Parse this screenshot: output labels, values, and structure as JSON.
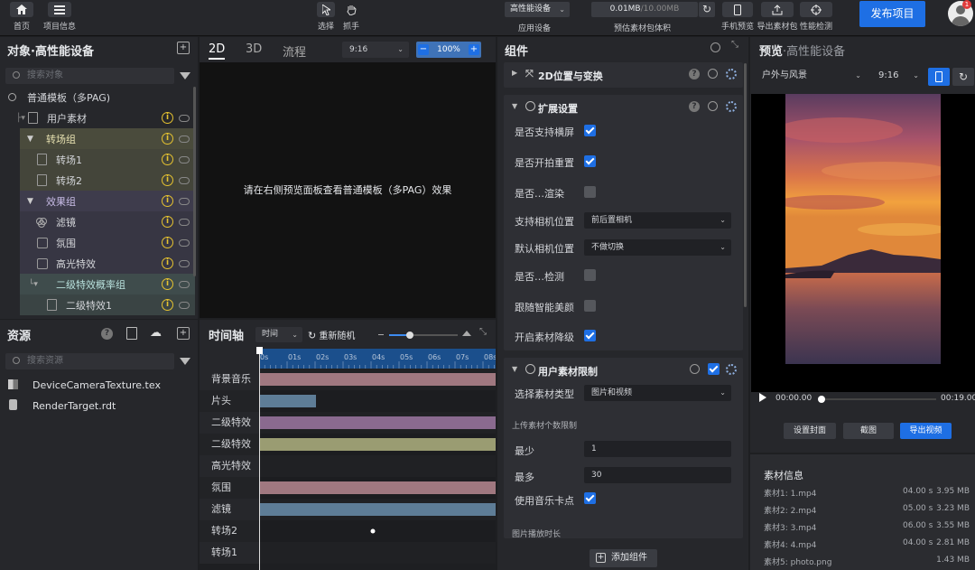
{
  "toolbar": {
    "home": "首页",
    "project_info": "项目信息",
    "select": "选择",
    "hand": "抓手",
    "device": "高性能设备",
    "apply_device": "应用设备",
    "size_used": "0.01MB",
    "size_total": "/10.00MB",
    "size_label": "预估素材包体积",
    "mobile_preview": "手机预览",
    "export_package": "导出素材包",
    "perf_check": "性能检测",
    "publish": "发布项目",
    "notif_count": "1"
  },
  "objects_panel": {
    "title": "对象·高性能设备",
    "search_placeholder": "搜索对象",
    "items": [
      {
        "label": "普通模板（多PAG)"
      },
      {
        "label": "用户素材"
      },
      {
        "label": "转场组"
      },
      {
        "label": "转场1"
      },
      {
        "label": "转场2"
      },
      {
        "label": "效果组"
      },
      {
        "label": "滤镜"
      },
      {
        "label": "氛围"
      },
      {
        "label": "高光特效"
      },
      {
        "label": "二级特效概率组"
      },
      {
        "label": "二级特效1"
      }
    ]
  },
  "canvas": {
    "tabs": [
      "2D",
      "3D",
      "流程"
    ],
    "ratio": "9:16",
    "zoom": "100%",
    "message": "请在右侧预览面板查看普通模板（多PAG）效果"
  },
  "resources": {
    "title": "资源",
    "search_placeholder": "搜索资源",
    "items": [
      "DeviceCameraTexture.tex",
      "RenderTarget.rdt"
    ]
  },
  "timeline": {
    "title": "时间轴",
    "mode": "时间",
    "reset": "重新随机",
    "ticks": [
      "0s",
      "01s",
      "02s",
      "03s",
      "04s",
      "05s",
      "06s",
      "07s",
      "08s"
    ],
    "tracks": [
      {
        "label": "背景音乐",
        "start": 0.0,
        "end": 8.5,
        "color": "#a07880"
      },
      {
        "label": "片头",
        "start": 0.0,
        "end": 2.0,
        "color": "#5e7d97"
      },
      {
        "label": "二级特效",
        "start": 0.0,
        "end": 8.5,
        "color": "#8a6a8f"
      },
      {
        "label": "二级特效",
        "start": 0.0,
        "end": 8.5,
        "color": "#9a9c72"
      },
      {
        "label": "高光特效",
        "start": 0.0,
        "end": 0.0,
        "color": "#777"
      },
      {
        "label": "氛围",
        "start": 0.0,
        "end": 8.5,
        "color": "#a07880"
      },
      {
        "label": "滤镜",
        "start": -0.3,
        "end": 8.5,
        "color": "#5e7d97"
      },
      {
        "label": "转场2",
        "start": 0.0,
        "end": 0.0,
        "color": "#777"
      },
      {
        "label": "转场1",
        "start": 0.0,
        "end": 0.0,
        "color": "#777"
      }
    ]
  },
  "components": {
    "title": "组件",
    "groups": {
      "transform": "2D位置与变换",
      "extend": "扩展设置",
      "user_limit": "用户素材限制"
    },
    "extend_rows": [
      {
        "label": "是否支持横屏",
        "checked": true
      },
      {
        "label": "是否开拍重置",
        "checked": true
      },
      {
        "label": "是否…渲染",
        "checked": false
      },
      {
        "label": "支持相机位置",
        "value": "前后置相机"
      },
      {
        "label": "默认相机位置",
        "value": "不做切换"
      },
      {
        "label": "是否…检测",
        "checked": false
      },
      {
        "label": "跟随智能美颜",
        "checked": false
      },
      {
        "label": "开启素材降级",
        "checked": true
      }
    ],
    "material_type_label": "选择素材类型",
    "material_type_value": "图片和视频",
    "upload_count_label": "上传素材个数限制",
    "min_label": "最少",
    "min_value": "1",
    "max_label": "最多",
    "max_value": "30",
    "music_label": "使用音乐卡点",
    "music_checked": true,
    "image_duration_label": "图片播放时长",
    "add_component": "添加组件"
  },
  "preview": {
    "title": "预览",
    "title_suffix": "·高性能设备",
    "scene": "户外与风景",
    "ratio": "9:16",
    "time_start": "00:00.00",
    "time_end": "00:19.00",
    "progress": 0.0,
    "set_cover": "设置封面",
    "screenshot": "截图",
    "export_video": "导出视频"
  },
  "materials": {
    "title": "素材信息",
    "items": [
      {
        "name": "素材1: 1.mp4",
        "duration": "04.00 s",
        "size": "3.95 MB"
      },
      {
        "name": "素材2: 2.mp4",
        "duration": "05.00 s",
        "size": "3.23 MB"
      },
      {
        "name": "素材3: 3.mp4",
        "duration": "06.00 s",
        "size": "3.55 MB"
      },
      {
        "name": "素材4: 4.mp4",
        "duration": "04.00 s",
        "size": "2.81 MB"
      },
      {
        "name": "素材5: photo.png",
        "duration": "",
        "size": "1.43 MB"
      }
    ]
  },
  "colors": {
    "accent": "#1e6fe4",
    "warning": "#e5c230"
  }
}
